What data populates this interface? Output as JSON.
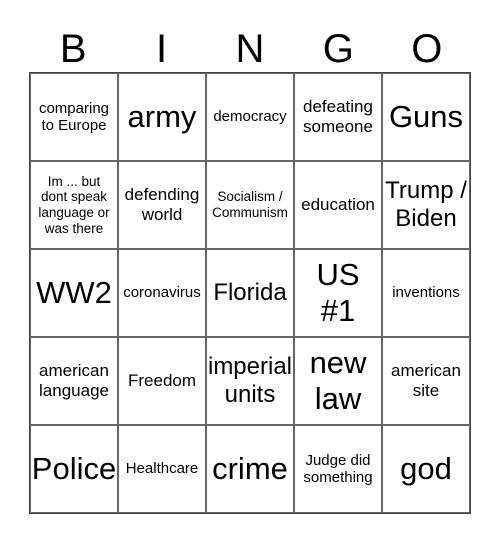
{
  "header": [
    "B",
    "I",
    "N",
    "G",
    "O"
  ],
  "cells": [
    {
      "text": "comparing to Europe",
      "size": "sm"
    },
    {
      "text": "army",
      "size": "xl"
    },
    {
      "text": "democracy",
      "size": "sm"
    },
    {
      "text": "defeating someone",
      "size": "md"
    },
    {
      "text": "Guns",
      "size": "xl"
    },
    {
      "text": "Im ... but dont speak language or was there",
      "size": "xs"
    },
    {
      "text": "defending world",
      "size": "md"
    },
    {
      "text": "Socialism / Communism",
      "size": "xs"
    },
    {
      "text": "education",
      "size": "md"
    },
    {
      "text": "Trump / Biden",
      "size": "lg"
    },
    {
      "text": "WW2",
      "size": "xl"
    },
    {
      "text": "coronavirus",
      "size": "sm"
    },
    {
      "text": "Florida",
      "size": "lg"
    },
    {
      "text": "US #1",
      "size": "xl"
    },
    {
      "text": "inventions",
      "size": "sm"
    },
    {
      "text": "american language",
      "size": "md"
    },
    {
      "text": "Freedom",
      "size": "md"
    },
    {
      "text": "imperial units",
      "size": "lg"
    },
    {
      "text": "new law",
      "size": "xl"
    },
    {
      "text": "american site",
      "size": "md"
    },
    {
      "text": "Police",
      "size": "xl"
    },
    {
      "text": "Healthcare",
      "size": "sm"
    },
    {
      "text": "crime",
      "size": "xl"
    },
    {
      "text": "Judge did something",
      "size": "sm"
    },
    {
      "text": "god",
      "size": "xl"
    }
  ]
}
